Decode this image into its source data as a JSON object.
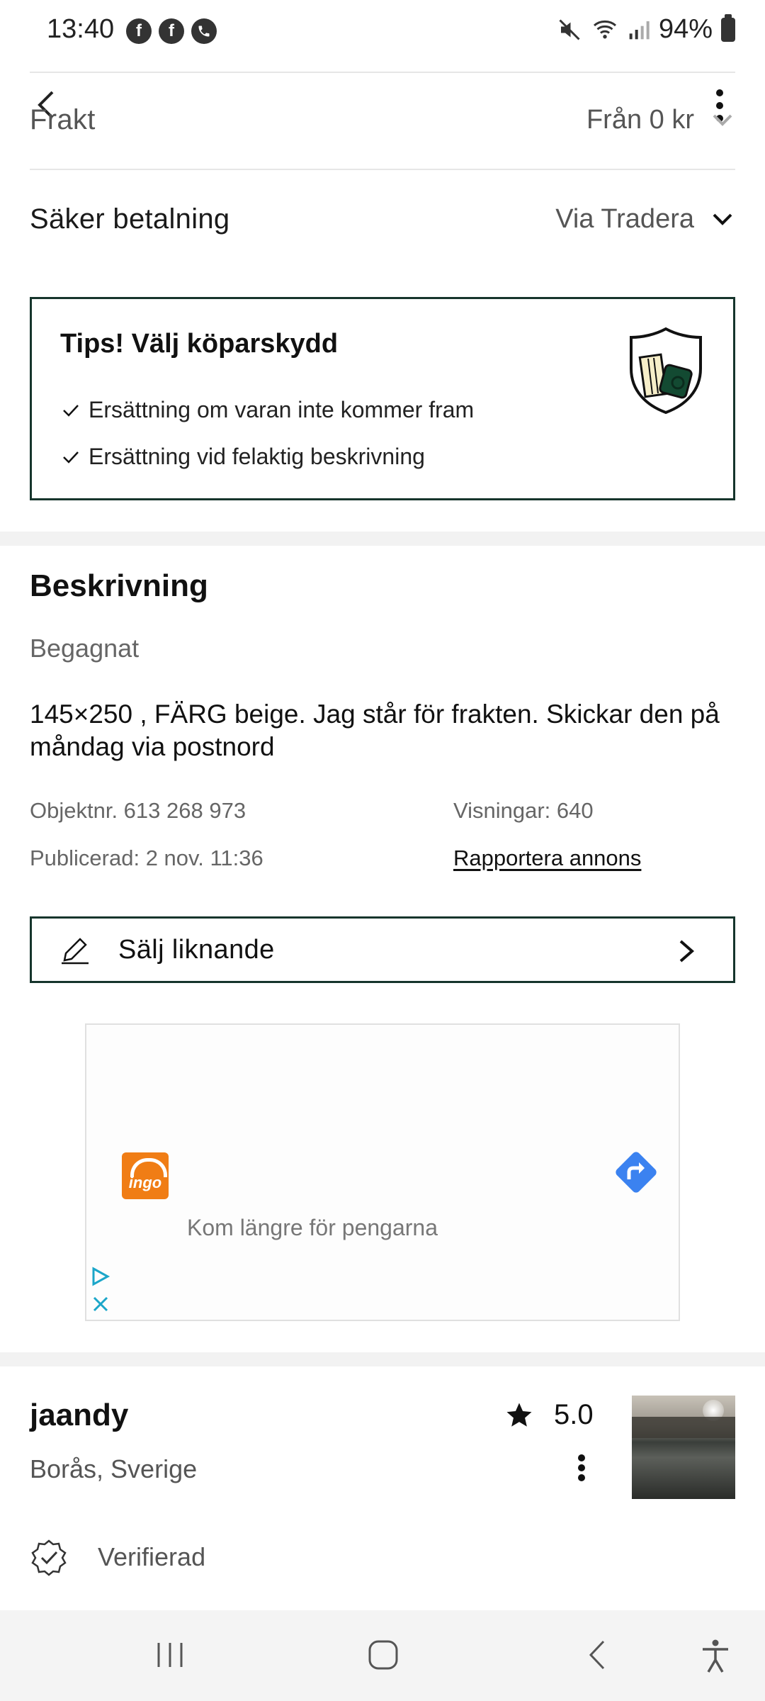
{
  "status_bar": {
    "time": "13:40",
    "notification_icons": [
      "facebook-icon",
      "facebook-icon",
      "phone-icon"
    ],
    "battery": "94%",
    "icons": [
      "mute-icon",
      "wifi-icon",
      "signal-icon",
      "battery-icon"
    ]
  },
  "header": {
    "back_icon": "chevron-left-icon",
    "more_icon": "more-vertical-icon"
  },
  "shipping": {
    "label": "Frakt",
    "value": "Från 0 kr"
  },
  "payment": {
    "label": "Säker betalning",
    "value": "Via Tradera"
  },
  "tips": {
    "title": "Tips! Välj köparskydd",
    "items": [
      "Ersättning om varan inte kommer fram",
      "Ersättning vid felaktig beskrivning"
    ]
  },
  "description": {
    "heading": "Beskrivning",
    "condition": "Begagnat",
    "text": "145×250 , FÄRG beige. Jag står för frakten. Skickar den på måndag via postnord",
    "object_number": "Objektnr. 613 268 973",
    "views": "Visningar: 640",
    "published": "Publicerad: 2 nov. 11:36",
    "report_link": "Rapportera annons"
  },
  "sell_similar": {
    "label": "Sälj liknande"
  },
  "ad": {
    "brand": "ingo",
    "text": "Kom längre för pengarna"
  },
  "seller": {
    "name": "jaandy",
    "rating": "5.0",
    "location": "Borås, Sverige",
    "verified_label": "Verifierad"
  },
  "nav": {
    "items": [
      "recents-icon",
      "home-icon",
      "back-icon",
      "accessibility-icon"
    ]
  },
  "colors": {
    "accent_border": "#16352c",
    "ad_arrow": "#3b82f0",
    "ad_logo": "#f07d15"
  }
}
